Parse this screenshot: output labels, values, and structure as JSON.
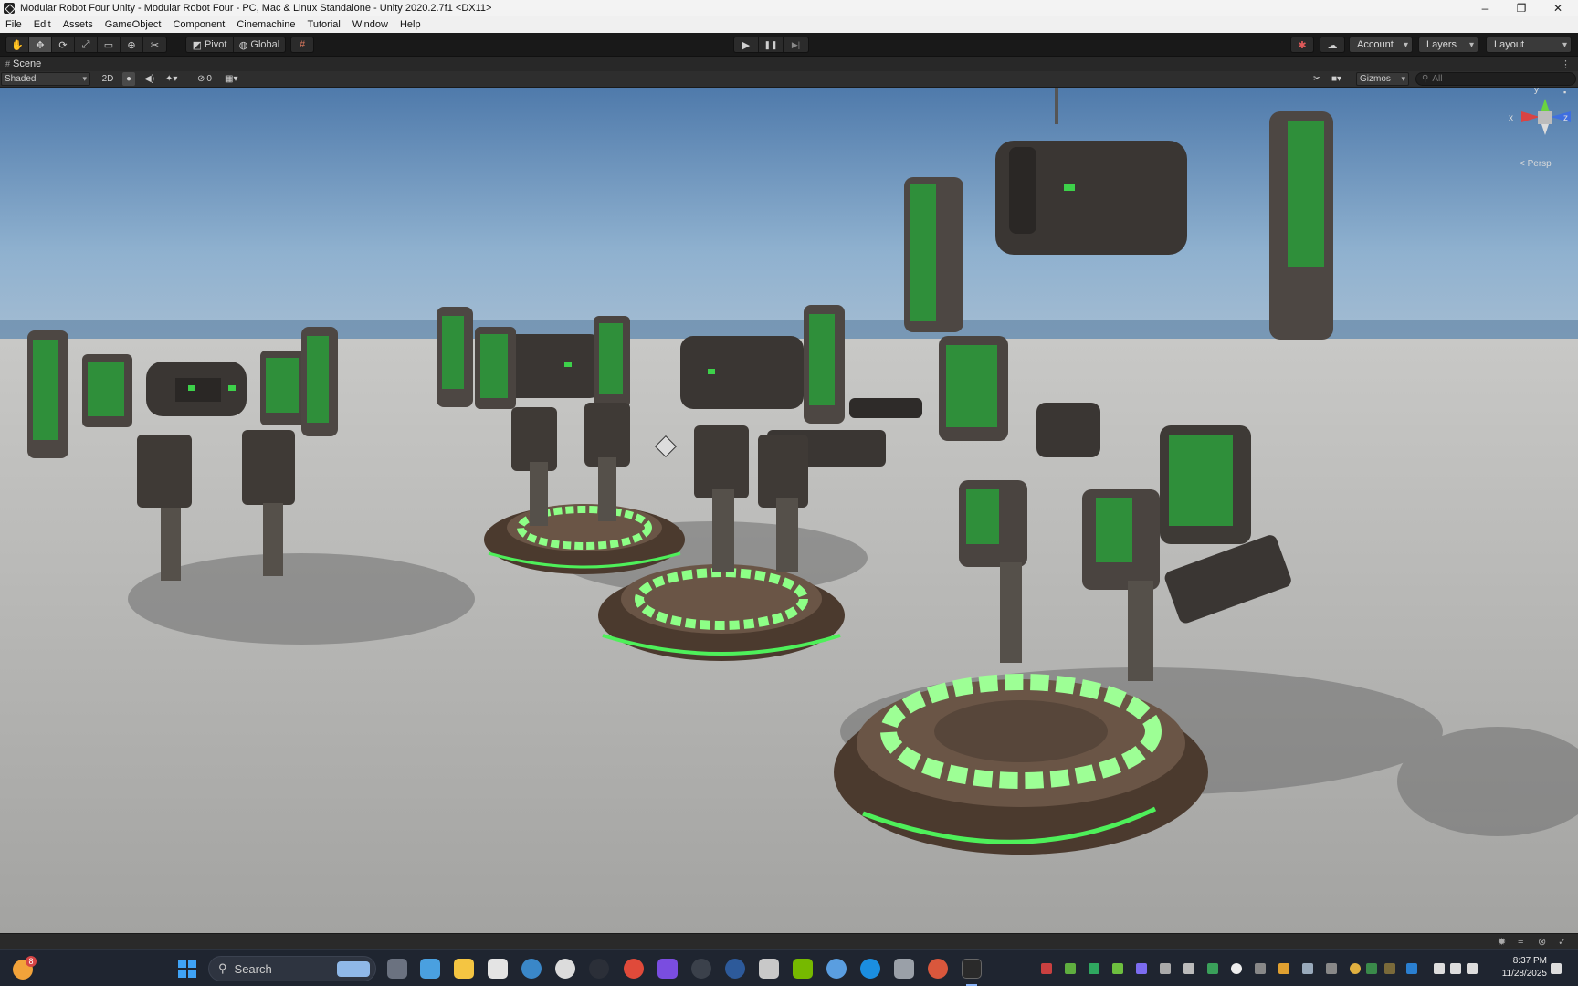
{
  "window": {
    "title": "Modular Robot Four Unity - Modular Robot Four - PC, Mac & Linux Standalone - Unity 2020.2.7f1 <DX11>",
    "controls": {
      "minimize": "–",
      "maximize": "❐",
      "close": "✕"
    }
  },
  "menu": [
    "File",
    "Edit",
    "Assets",
    "GameObject",
    "Component",
    "Cinemachine",
    "Tutorial",
    "Window",
    "Help"
  ],
  "toolbar": {
    "tools": [
      "hand-icon",
      "move-icon",
      "rotate-icon",
      "scale-icon",
      "rect-icon",
      "transform-icon",
      "custom-tool-icon"
    ],
    "pivot_label": "Pivot",
    "global_label": "Global",
    "grid_snap": "grid-snap-icon",
    "play": "▶",
    "pause": "❚❚",
    "step": "▶|",
    "account_label": "Account",
    "layers_label": "Layers",
    "layout_label": "Layout"
  },
  "scene": {
    "tab_label": "Scene",
    "shading_mode": "Shaded",
    "mode_2d": "2D",
    "hidden_count": "0",
    "gizmos_label": "Gizmos",
    "search_placeholder": "All",
    "persp_label": "< Persp",
    "axes": {
      "x": "x",
      "y": "y",
      "z": "z"
    }
  },
  "taskbar": {
    "search_label": "Search",
    "notification_count": "8",
    "time": "8:37 PM",
    "date": "11/28/2025"
  },
  "colors": {
    "accent_green": "#3dd14a",
    "sky_top": "#4f7aab",
    "ground": "#b7b8b7"
  }
}
